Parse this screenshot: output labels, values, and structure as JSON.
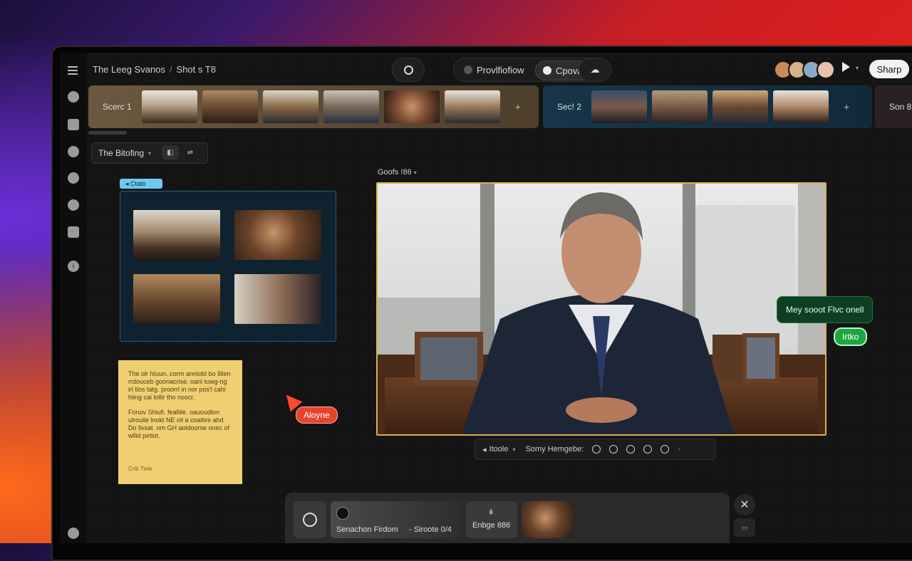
{
  "breadcrumb": {
    "project": "The Leeg Svanos",
    "separator": "/",
    "shot": "Shot s T8"
  },
  "topbar": {
    "mode_left": "Provlfiofiow",
    "mode_right": "Cpovas",
    "share": "Sharp"
  },
  "scenes": [
    {
      "label": "Scerc 1",
      "add": "+"
    },
    {
      "label": "Sec! 2",
      "add": "+"
    },
    {
      "label": "Son 8"
    }
  ],
  "board": {
    "title": "The Bitofing",
    "tag": "Ctato"
  },
  "shot": {
    "label": "Goofs !86"
  },
  "note": {
    "para1": "The olr hIuun. corrn anniobl bo Ililen rrdouceb goonacrise. oanl tuwg-ng irl tlos tatg. proorrl in nor pos'l cahi hiing cai lollir tho noscr.",
    "para2": "Fonov Shiufi. feafiile. oauoudlon ulrouile lnokt NE oil a coaitire ahd Do llvsat. nm GH aoidoorse onec of wllid pirtiot.",
    "signature": "Crib Tiele"
  },
  "cursor": {
    "name": "Aloyne"
  },
  "chat": {
    "message": "Mey sooot Flvc onell",
    "name": "Irtko"
  },
  "controls": {
    "left": "Itoole",
    "middle": "Somy Hemgebe:"
  },
  "dock": {
    "track": "Senachon Firdom",
    "track_right": "- Siroote 0/4",
    "item_label": "Enbge 886",
    "item_icon": "ǂ"
  },
  "colors": {
    "accent_orange": "#e8432c",
    "accent_green": "#1ea640",
    "shot_border": "#d8b04e",
    "note_yellow": "#f0cf73"
  }
}
